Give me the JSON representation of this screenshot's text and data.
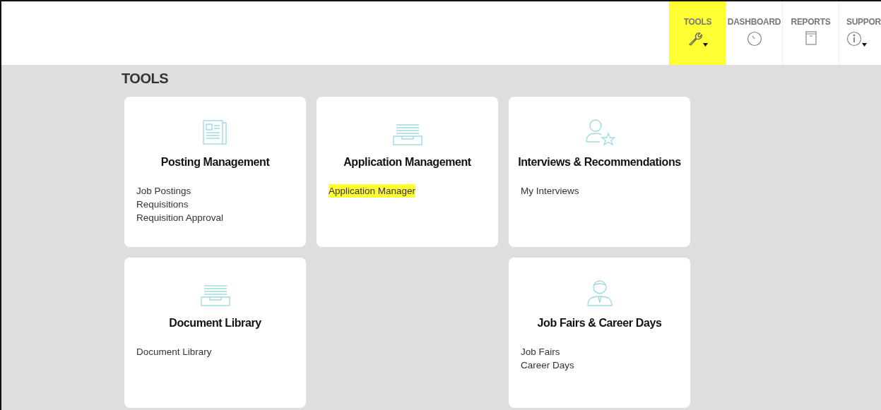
{
  "nav": [
    {
      "label": "TOOLS",
      "kind": "wrench",
      "dropdown": true,
      "highlighted": true
    },
    {
      "label": "DASHBOARD",
      "kind": "dial",
      "dropdown": false,
      "highlighted": false
    },
    {
      "label": "REPORTS",
      "kind": "report",
      "dropdown": false,
      "highlighted": false
    },
    {
      "label": "SUPPOR",
      "kind": "info",
      "dropdown": true,
      "highlighted": false
    }
  ],
  "page_title": "TOOLS",
  "cards": [
    {
      "kind": "newspaper",
      "title": "Posting Management",
      "links": [
        {
          "label": "Job Postings",
          "highlighted": false
        },
        {
          "label": "Requisitions",
          "highlighted": false
        },
        {
          "label": "Requisition Approval",
          "highlighted": false
        }
      ]
    },
    {
      "kind": "tray",
      "title": "Application Management",
      "links": [
        {
          "label": "Application Manager",
          "highlighted": true
        }
      ]
    },
    {
      "kind": "person-star",
      "title": "Interviews & Recommendations",
      "links": [
        {
          "label": "My Interviews",
          "highlighted": false
        }
      ]
    },
    {
      "kind": "tray",
      "title": "Document Library",
      "links": [
        {
          "label": "Document Library",
          "highlighted": false
        }
      ]
    },
    {
      "kind": "empty"
    },
    {
      "kind": "person-tie",
      "title": "Job Fairs & Career Days",
      "links": [
        {
          "label": "Job Fairs",
          "highlighted": false
        },
        {
          "label": "Career Days",
          "highlighted": false
        }
      ]
    }
  ]
}
